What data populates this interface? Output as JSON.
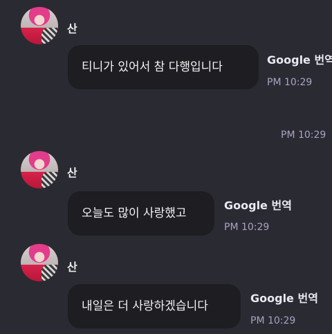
{
  "messages": [
    {
      "sender": "산",
      "text": "티니가 있어서 참 다행입니다",
      "translate_label": "Google 번역",
      "time": "PM 10:29"
    },
    {
      "time": "PM 10:29"
    },
    {
      "sender": "산",
      "text": "오늘도 많이 사랑했고",
      "translate_label": "Google 번역",
      "time": "PM 10:29"
    },
    {
      "sender": "산",
      "text": "내일은 더 사랑하겠습니다",
      "translate_label": "Google 번역",
      "time": "PM 10:29"
    }
  ],
  "icons": {
    "avatar": "profile-photo"
  }
}
